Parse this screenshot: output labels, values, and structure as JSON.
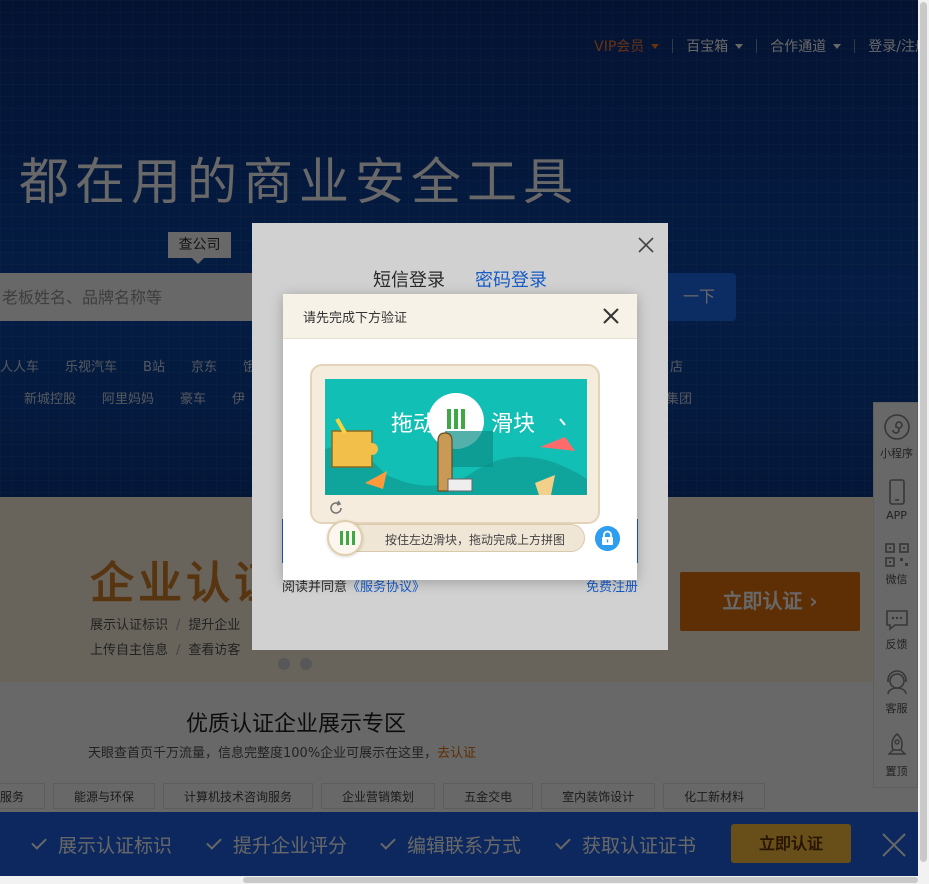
{
  "topnav": {
    "vip": "VIP会员",
    "treasure": "百宝箱",
    "cooperation": "合作通道",
    "login": "登录/注册"
  },
  "hero": {
    "slogan": "都在用的商业安全工具",
    "search_tag": "查公司",
    "search_placeholder": "老板姓名、品牌名称等",
    "search_button": "一下",
    "hot_row_1": [
      "人人车",
      "乐视汽车",
      "B站",
      "京东",
      "饿"
    ],
    "hot_row_2": [
      "新城控股",
      "阿里妈妈",
      "豪车",
      "伊"
    ],
    "hot_right_1": "店",
    "hot_right_2": "集团"
  },
  "cert": {
    "title": "企业认证",
    "links_1": [
      "展示认证标识",
      "提升企业"
    ],
    "links_2": [
      "上传自主信息",
      "查看访客"
    ],
    "button": "立即认证 ›"
  },
  "showcase": {
    "title": "优质认证企业展示专区",
    "subtitle": "天眼查首页千万流量，信息完整度100%企业可展示在这里，",
    "subtitle_link": "去认证",
    "chips": [
      "服务",
      "能源与环保",
      "计算机技术咨询服务",
      "企业营销策划",
      "五金交电",
      "室内装饰设计",
      "化工新材料"
    ]
  },
  "bottom_bar": {
    "items": [
      "展示认证标识",
      "提升企业评分",
      "编辑联系方式",
      "获取认证证书"
    ],
    "button": "立即认证",
    "colors": {
      "bar": "#1f62e6",
      "button": "#ffc23e"
    }
  },
  "side_tools": {
    "mini_program": "小程序",
    "app": "APP",
    "wechat": "微信",
    "feedback": "反馈",
    "service": "客服",
    "top": "置顶"
  },
  "login_modal": {
    "tab_sms": "短信登录",
    "tab_password": "密码登录",
    "agree_text": "阅读并同意",
    "agree_link": "《服务协议》",
    "register": "免费注册"
  },
  "verify_modal": {
    "title": "请先完成下方验证",
    "image_text_1": "拖动",
    "image_text_2": "滑块",
    "slider_hint": "按住左边滑块，拖动完成上方拼图"
  }
}
